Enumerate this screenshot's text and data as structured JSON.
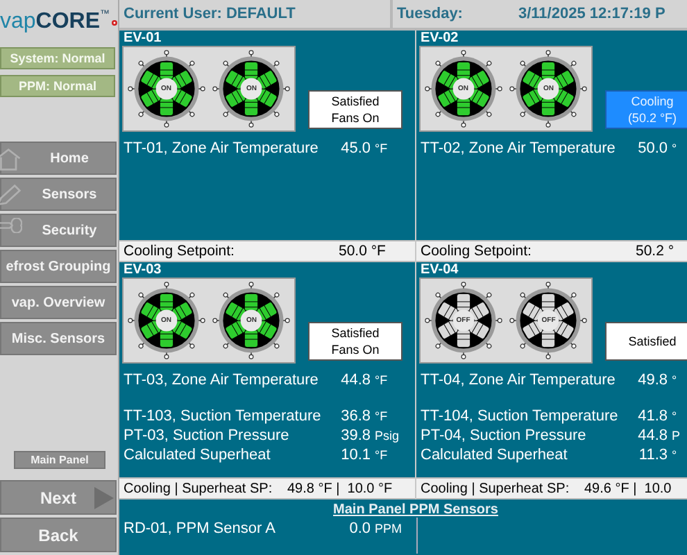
{
  "sidebar": {
    "logo_prefix": "vap",
    "logo_main": "CORE",
    "tm": "™",
    "statuses": [
      "System: Normal",
      "PPM: Normal"
    ],
    "nav": [
      {
        "label": "Home"
      },
      {
        "label": "Sensors"
      },
      {
        "label": "Security"
      },
      {
        "label": "efrost Grouping"
      },
      {
        "label": "vap. Overview"
      },
      {
        "label": "Misc. Sensors"
      }
    ],
    "main_panel_button": "Main Panel",
    "next_button": "Next",
    "back_button": "Back"
  },
  "header": {
    "user": "Current User: DEFAULT",
    "day": "Tuesday:",
    "datetime": "3/11/2025 12:17:19 P"
  },
  "panels": [
    {
      "title": "EV-01",
      "fans": [
        {
          "on": true,
          "label": "ON"
        },
        {
          "on": true,
          "label": "ON"
        }
      ],
      "status": {
        "kind": "satisfied",
        "text": "Satisfied\nFans On"
      },
      "readings": [
        [
          {
            "label": "TT-01, Zone Air Temperature",
            "value": "45.0",
            "unit": "°F"
          }
        ]
      ],
      "footer": {
        "label": "Cooling Setpoint:",
        "value": "50.0 °F"
      }
    },
    {
      "title": "EV-02",
      "fans": [
        {
          "on": true,
          "label": "ON"
        },
        {
          "on": true,
          "label": "ON"
        }
      ],
      "status": {
        "kind": "cooling",
        "text": "Cooling\n(50.2 °F)"
      },
      "readings": [
        [
          {
            "label": "TT-02, Zone Air Temperature",
            "value": "50.0",
            "unit": "°"
          }
        ]
      ],
      "footer": {
        "label": "Cooling Setpoint:",
        "value": "50.2 °"
      }
    },
    {
      "title": "EV-03",
      "fans": [
        {
          "on": true,
          "label": "ON"
        },
        {
          "on": true,
          "label": "ON"
        }
      ],
      "status": {
        "kind": "satisfied",
        "text": "Satisfied\nFans On"
      },
      "readings": [
        [
          {
            "label": "TT-03, Zone Air Temperature",
            "value": "44.8",
            "unit": "°F"
          }
        ],
        [
          {
            "label": "TT-103, Suction Temperature",
            "value": "36.8",
            "unit": "°F"
          },
          {
            "label": "PT-03, Suction Pressure",
            "value": "39.8",
            "unit": "Psig"
          },
          {
            "label": "Calculated Superheat",
            "value": "10.1",
            "unit": "°F"
          }
        ]
      ],
      "footer": {
        "label": "Cooling | Superheat SP:",
        "value": "49.8 °F |  10.0 °F"
      }
    },
    {
      "title": "EV-04",
      "fans": [
        {
          "on": false,
          "label": "OFF"
        },
        {
          "on": false,
          "label": "OFF"
        }
      ],
      "status": {
        "kind": "satisfied",
        "text": "Satisfied"
      },
      "readings": [
        [
          {
            "label": "TT-04, Zone Air Temperature",
            "value": "49.8",
            "unit": "°"
          }
        ],
        [
          {
            "label": "TT-104, Suction Temperature",
            "value": "41.8",
            "unit": "°"
          },
          {
            "label": "PT-04, Suction Pressure",
            "value": "44.8",
            "unit": "P"
          },
          {
            "label": "Calculated Superheat",
            "value": "11.3",
            "unit": "°"
          }
        ]
      ],
      "footer": {
        "label": "Cooling | Superheat SP:",
        "value": "49.6 °F |  10.0"
      }
    }
  ],
  "ppm": {
    "title": "Main Panel PPM Sensors",
    "sensors": [
      {
        "label": "RD-01, PPM Sensor A",
        "value": "0.0",
        "unit": "PPM"
      }
    ]
  }
}
